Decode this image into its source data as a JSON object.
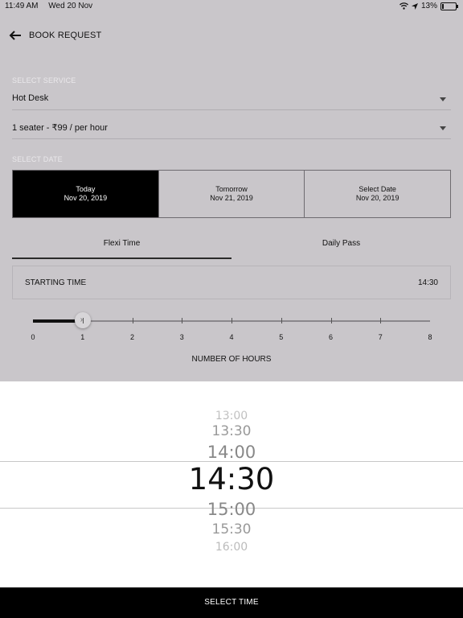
{
  "status_bar": {
    "time": "11:49 AM",
    "date": "Wed 20 Nov",
    "battery": "13%"
  },
  "header": {
    "title": "BOOK REQUEST"
  },
  "service": {
    "label": "SELECT SERVICE",
    "service_value": "Hot Desk",
    "plan_value": "1 seater - ₹99 / per hour"
  },
  "date": {
    "label": "SELECT DATE",
    "options": [
      {
        "title": "Today",
        "date": "Nov 20, 2019"
      },
      {
        "title": "Tomorrow",
        "date": "Nov 21, 2019"
      },
      {
        "title": "Select Date",
        "date": "Nov 20, 2019"
      }
    ]
  },
  "tabs": [
    {
      "label": "Flexi Time"
    },
    {
      "label": "Daily Pass"
    }
  ],
  "starting_time": {
    "label": "STARTING TIME",
    "value": "14:30"
  },
  "hours_slider": {
    "ticks": [
      "0",
      "1",
      "2",
      "3",
      "4",
      "5",
      "6",
      "7",
      "8"
    ],
    "value": 1,
    "max": 8,
    "label": "NUMBER OF HOURS"
  },
  "time_picker": {
    "items": [
      "13:00",
      "13:30",
      "14:00",
      "14:30",
      "15:00",
      "15:30",
      "16:00"
    ],
    "selected": "14:30"
  },
  "footer": {
    "button_label": "SELECT TIME"
  }
}
